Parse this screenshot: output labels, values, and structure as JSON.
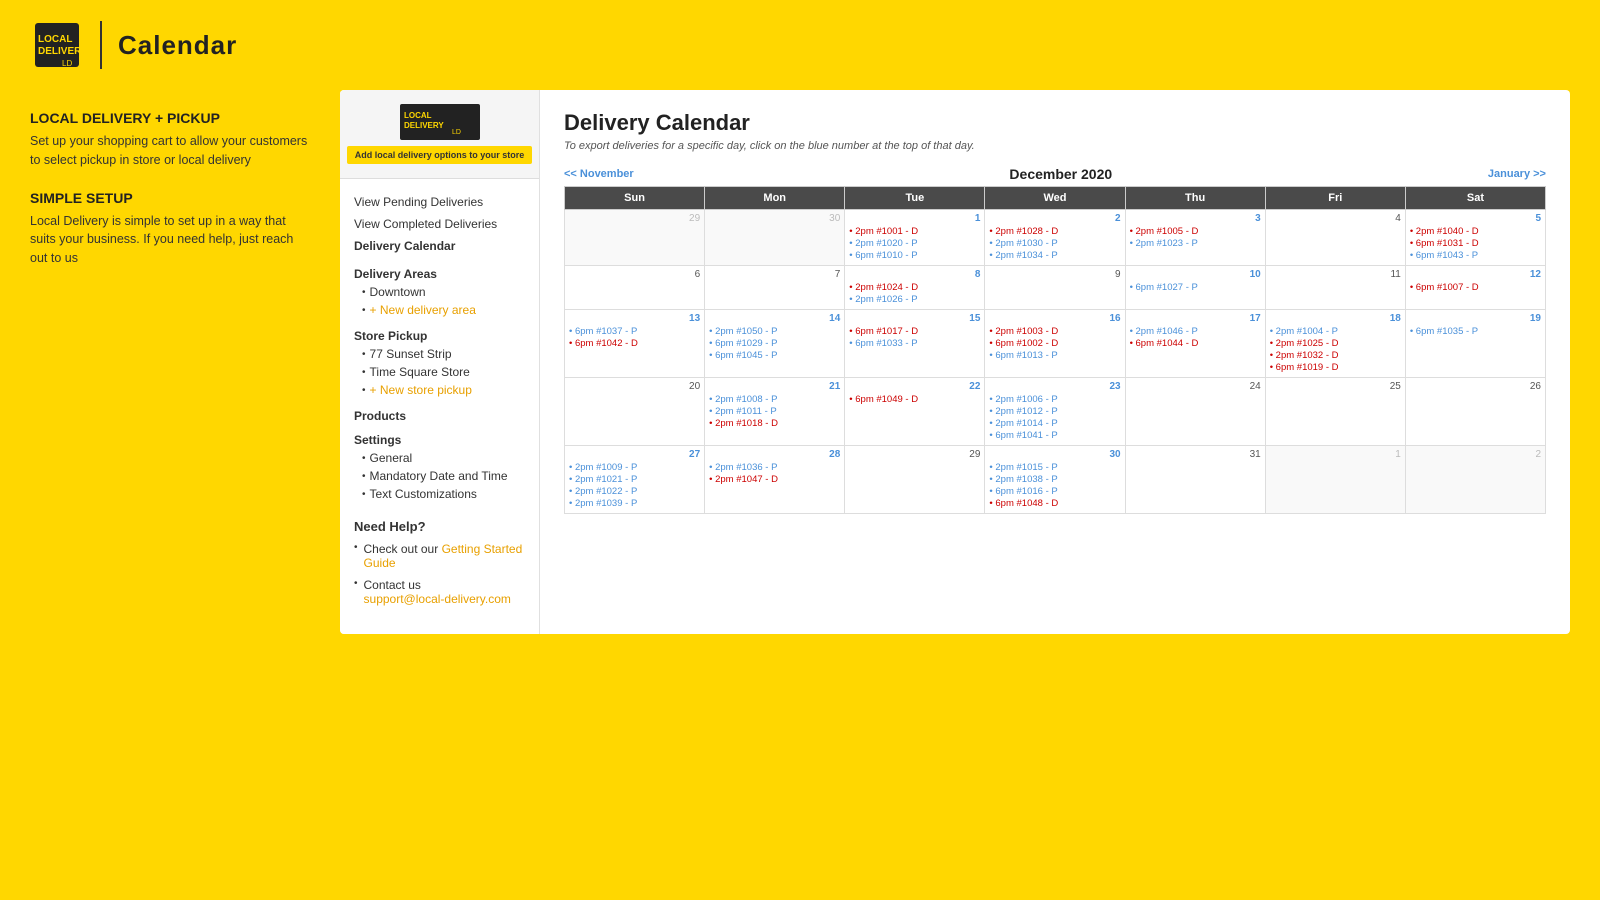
{
  "header": {
    "title": "Calendar",
    "logo_alt": "Local Delivery"
  },
  "left_sidebar": {
    "local_delivery_heading": "LOCAL DELIVERY + PICKUP",
    "local_delivery_text": "Set up your shopping cart to allow your customers to select pickup in store or local delivery",
    "simple_setup_heading": "SIMPLE SETUP",
    "simple_setup_text": "Local Delivery is simple to set up in a way that suits your business. If you need help, just reach out to us"
  },
  "inner_sidebar": {
    "add_btn_label": "Add local delivery options to your store",
    "nav_items": [
      {
        "label": "View Pending Deliveries",
        "active": false
      },
      {
        "label": "View Completed Deliveries",
        "active": false
      },
      {
        "label": "Delivery Calendar",
        "active": true
      }
    ],
    "delivery_areas_label": "Delivery Areas",
    "delivery_areas": [
      {
        "label": "Downtown"
      },
      {
        "label": "+ New delivery area",
        "add": true
      }
    ],
    "store_pickup_label": "Store Pickup",
    "store_pickups": [
      {
        "label": "77 Sunset Strip"
      },
      {
        "label": "Time Square Store"
      },
      {
        "label": "+ New store pickup",
        "add": true
      }
    ],
    "products_label": "Products",
    "settings_label": "Settings",
    "settings_items": [
      {
        "label": "General"
      },
      {
        "label": "Mandatory Date and Time"
      },
      {
        "label": "Text Customizations"
      }
    ]
  },
  "need_help": {
    "title": "Need Help?",
    "items": [
      {
        "prefix": "Check out our ",
        "link_text": "Getting Started Guide",
        "suffix": ""
      },
      {
        "prefix": "Contact us",
        "link_text": "",
        "suffix": ""
      },
      {
        "prefix": "support@local-delivery.com",
        "link_text": "",
        "suffix": ""
      }
    ]
  },
  "calendar": {
    "title": "Delivery Calendar",
    "subtitle": "To export deliveries for a specific day, click on the blue number at the top of that day.",
    "month_label": "December 2020",
    "prev_nav": "<< November",
    "next_nav": "January >>",
    "days": [
      "Sun",
      "Mon",
      "Tue",
      "Wed",
      "Thu",
      "Fri",
      "Sat"
    ],
    "weeks": [
      [
        {
          "day": "29",
          "prev": true,
          "items": []
        },
        {
          "day": "30",
          "prev": true,
          "items": []
        },
        {
          "day": "1",
          "items": [
            {
              "time": "2pm",
              "order": "#1001",
              "type": "D"
            },
            {
              "time": "2pm",
              "order": "#1020",
              "type": "P"
            },
            {
              "time": "6pm",
              "order": "#1010",
              "type": "P"
            }
          ]
        },
        {
          "day": "2",
          "items": [
            {
              "time": "2pm",
              "order": "#1028",
              "type": "D"
            },
            {
              "time": "2pm",
              "order": "#1030",
              "type": "P"
            },
            {
              "time": "2pm",
              "order": "#1034",
              "type": "P"
            }
          ]
        },
        {
          "day": "3",
          "items": [
            {
              "time": "2pm",
              "order": "#1005",
              "type": "D"
            },
            {
              "time": "2pm",
              "order": "#1023",
              "type": "P"
            }
          ]
        },
        {
          "day": "4",
          "items": []
        },
        {
          "day": "5",
          "items": [
            {
              "time": "2pm",
              "order": "#1040",
              "type": "D"
            },
            {
              "time": "6pm",
              "order": "#1031",
              "type": "D"
            },
            {
              "time": "6pm",
              "order": "#1043",
              "type": "P"
            }
          ]
        }
      ],
      [
        {
          "day": "6",
          "items": []
        },
        {
          "day": "7",
          "items": []
        },
        {
          "day": "8",
          "items": [
            {
              "time": "2pm",
              "order": "#1024",
              "type": "D"
            },
            {
              "time": "2pm",
              "order": "#1026",
              "type": "P"
            }
          ]
        },
        {
          "day": "9",
          "items": []
        },
        {
          "day": "10",
          "items": [
            {
              "time": "6pm",
              "order": "#1027",
              "type": "P"
            }
          ]
        },
        {
          "day": "11",
          "items": []
        },
        {
          "day": "12",
          "items": [
            {
              "time": "6pm",
              "order": "#1007",
              "type": "D"
            }
          ]
        }
      ],
      [
        {
          "day": "13",
          "items": [
            {
              "time": "6pm",
              "order": "#1037",
              "type": "P"
            },
            {
              "time": "6pm",
              "order": "#1042",
              "type": "D"
            }
          ]
        },
        {
          "day": "14",
          "items": [
            {
              "time": "2pm",
              "order": "#1050",
              "type": "P"
            },
            {
              "time": "6pm",
              "order": "#1029",
              "type": "P"
            },
            {
              "time": "6pm",
              "order": "#1045",
              "type": "P"
            }
          ]
        },
        {
          "day": "15",
          "items": [
            {
              "time": "6pm",
              "order": "#1017",
              "type": "D"
            },
            {
              "time": "6pm",
              "order": "#1033",
              "type": "P"
            }
          ]
        },
        {
          "day": "16",
          "items": [
            {
              "time": "2pm",
              "order": "#1003",
              "type": "D"
            },
            {
              "time": "6pm",
              "order": "#1002",
              "type": "D"
            },
            {
              "time": "6pm",
              "order": "#1013",
              "type": "P"
            }
          ]
        },
        {
          "day": "17",
          "items": [
            {
              "time": "2pm",
              "order": "#1046",
              "type": "P"
            },
            {
              "time": "6pm",
              "order": "#1044",
              "type": "D"
            }
          ]
        },
        {
          "day": "18",
          "items": [
            {
              "time": "2pm",
              "order": "#1004",
              "type": "P"
            },
            {
              "time": "2pm",
              "order": "#1025",
              "type": "D"
            },
            {
              "time": "2pm",
              "order": "#1032",
              "type": "D"
            },
            {
              "time": "6pm",
              "order": "#1019",
              "type": "D"
            }
          ]
        },
        {
          "day": "19",
          "items": [
            {
              "time": "6pm",
              "order": "#1035",
              "type": "P"
            }
          ]
        }
      ],
      [
        {
          "day": "20",
          "items": []
        },
        {
          "day": "21",
          "items": [
            {
              "time": "2pm",
              "order": "#1008",
              "type": "P"
            },
            {
              "time": "2pm",
              "order": "#1011",
              "type": "P"
            },
            {
              "time": "2pm",
              "order": "#1018",
              "type": "D"
            }
          ]
        },
        {
          "day": "22",
          "items": [
            {
              "time": "6pm",
              "order": "#1049",
              "type": "D"
            }
          ]
        },
        {
          "day": "23",
          "items": [
            {
              "time": "2pm",
              "order": "#1006",
              "type": "P"
            },
            {
              "time": "2pm",
              "order": "#1012",
              "type": "P"
            },
            {
              "time": "2pm",
              "order": "#1014",
              "type": "P"
            },
            {
              "time": "6pm",
              "order": "#1041",
              "type": "P"
            }
          ]
        },
        {
          "day": "24",
          "items": []
        },
        {
          "day": "25",
          "items": []
        },
        {
          "day": "26",
          "items": []
        }
      ],
      [
        {
          "day": "27",
          "items": [
            {
              "time": "2pm",
              "order": "#1009",
              "type": "P"
            },
            {
              "time": "2pm",
              "order": "#1021",
              "type": "P"
            },
            {
              "time": "2pm",
              "order": "#1022",
              "type": "P"
            },
            {
              "time": "2pm",
              "order": "#1039",
              "type": "P"
            }
          ]
        },
        {
          "day": "28",
          "items": [
            {
              "time": "2pm",
              "order": "#1036",
              "type": "P"
            },
            {
              "time": "2pm",
              "order": "#1047",
              "type": "D"
            }
          ]
        },
        {
          "day": "29",
          "items": []
        },
        {
          "day": "30",
          "items": [
            {
              "time": "2pm",
              "order": "#1015",
              "type": "P"
            },
            {
              "time": "2pm",
              "order": "#1038",
              "type": "P"
            },
            {
              "time": "6pm",
              "order": "#1016",
              "type": "P"
            },
            {
              "time": "6pm",
              "order": "#1048",
              "type": "D"
            }
          ]
        },
        {
          "day": "31",
          "items": []
        },
        {
          "day": "1",
          "next": true,
          "items": []
        },
        {
          "day": "2",
          "next": true,
          "items": []
        }
      ]
    ]
  }
}
